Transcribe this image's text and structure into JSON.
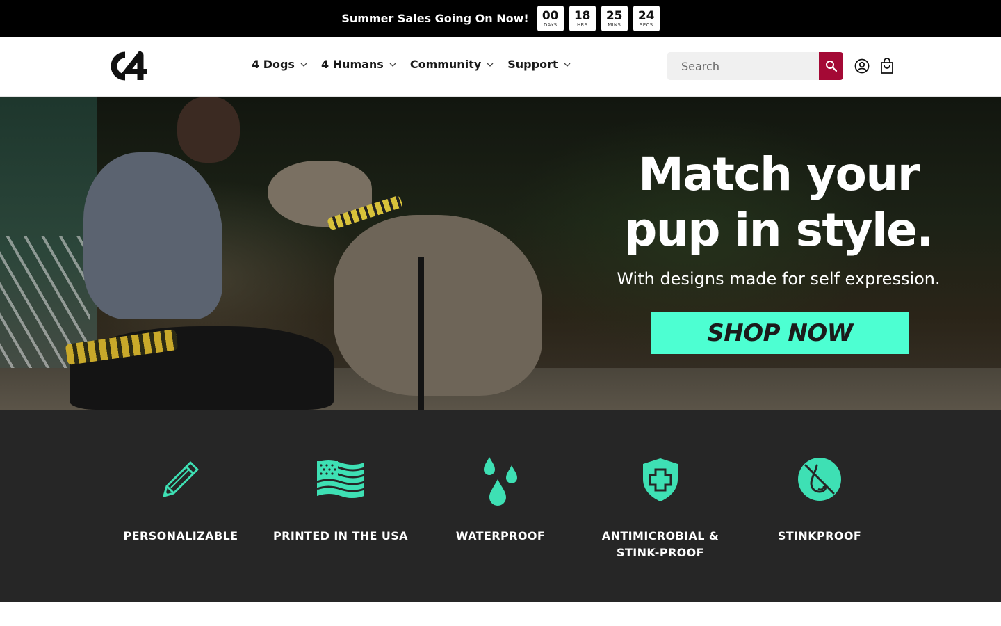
{
  "announcement": {
    "text": "Summer Sales Going On Now!",
    "countdown": [
      {
        "value": "00",
        "unit": "DAYS"
      },
      {
        "value": "18",
        "unit": "HRS"
      },
      {
        "value": "25",
        "unit": "MINS"
      },
      {
        "value": "24",
        "unit": "SECS"
      }
    ]
  },
  "header": {
    "logo_text": "C4",
    "nav": [
      {
        "label": "4 Dogs",
        "icon": "chevron-down-icon"
      },
      {
        "label": "4 Humans",
        "icon": "chevron-down-icon"
      },
      {
        "label": "Community",
        "icon": "chevron-down-icon"
      },
      {
        "label": "Support",
        "icon": "chevron-down-icon"
      }
    ],
    "search": {
      "placeholder": "Search",
      "button_icon": "search-icon"
    },
    "account_icon": "account-icon",
    "cart_icon": "cart-icon"
  },
  "hero": {
    "headline_line1": "Match your",
    "headline_line2": "pup in style.",
    "subheadline": "With designs made for self expression.",
    "cta_label": "SHOP NOW"
  },
  "features": [
    {
      "icon": "pencil-icon",
      "label": "PERSONALIZABLE"
    },
    {
      "icon": "us-flag-icon",
      "label": "PRINTED IN THE USA"
    },
    {
      "icon": "water-drops-icon",
      "label": "WATERPROOF"
    },
    {
      "icon": "shield-plus-icon",
      "label": "ANTIMICROBIAL & STINK-PROOF"
    },
    {
      "icon": "no-smell-icon",
      "label": "STINKPROOF"
    }
  ],
  "colors": {
    "announcement_bg": "#000000",
    "search_button": "#a40935",
    "cta": "#4dffd2",
    "feature_icons": "#3ee0b4",
    "features_bg": "#262626"
  }
}
